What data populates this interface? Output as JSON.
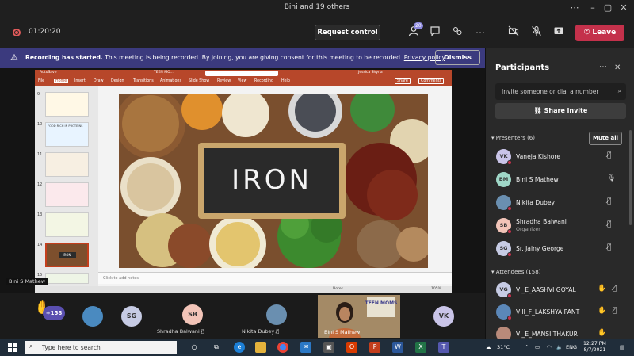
{
  "window": {
    "title": "Bini and 19 others"
  },
  "toolbar": {
    "timer": "01:20:20",
    "request_control": "Request control",
    "participants_badge": "20",
    "leave": "Leave"
  },
  "banner": {
    "bold": "Recording has started.",
    "text": " This meeting is being recorded. By joining, you are giving consent for this meeting to be recorded. ",
    "link": "Privacy policy",
    "dismiss": "Dismiss"
  },
  "ppt": {
    "autosave": "AutoSave",
    "doc_title": "TEEN MO...",
    "search": "Search",
    "user": "Jessica Shyna",
    "tabs": [
      "File",
      "Home",
      "Insert",
      "Draw",
      "Design",
      "Transitions",
      "Animations",
      "Slide Show",
      "Review",
      "View",
      "Recording",
      "Help"
    ],
    "share": "Share",
    "comments": "Comments",
    "thumbs": [
      "9",
      "10",
      "11",
      "12",
      "13",
      "14",
      "15"
    ],
    "thumb_texts": [
      "FOOD RICH IN PROTEINS",
      "IRON"
    ],
    "slide_word": "IRON",
    "notes": "Click to add notes",
    "status_notes": "Notes",
    "zoom": "105%"
  },
  "stage": {
    "presenter_label": "Bini S Mathew"
  },
  "panel": {
    "title": "Participants",
    "invite_placeholder": "Invite someone or dial a number",
    "share_invite": "Share invite",
    "presenters_head": "Presenters (6)",
    "mute_all": "Mute all",
    "attendees_head": "Attendees (158)",
    "presenters": [
      {
        "initials": "VK",
        "name": "Vaneja Kishore",
        "role": "",
        "color": "#c9c4e8"
      },
      {
        "initials": "BM",
        "name": "Bini S Mathew",
        "role": "",
        "color": "#9fd7c7"
      },
      {
        "initials": "",
        "name": "Nikita Dubey",
        "role": "",
        "color": "#6a8fb0"
      },
      {
        "initials": "SB",
        "name": "Shradha Balwani",
        "role": "Organizer",
        "color": "#f2c4b8"
      },
      {
        "initials": "SG",
        "name": "Sr. Jainy George",
        "role": "",
        "color": "#c6cbe4"
      }
    ],
    "attendees": [
      {
        "initials": "VG",
        "name": "VI_E_AASHVI GOYAL",
        "color": "#c6cbe4"
      },
      {
        "initials": "",
        "name": "VIII_F_LAKSHYA PANT",
        "color": "#5b87b8"
      },
      {
        "initials": "",
        "name": "VI_E_MANSI THAKUR",
        "color": "#b98a7a"
      }
    ]
  },
  "gallery": {
    "raised_count": "+158",
    "tiles": [
      {
        "initials": "",
        "name": "",
        "color": "#4a8ac0"
      },
      {
        "initials": "SG",
        "name": "",
        "color": "#c6cbe4"
      },
      {
        "initials": "SB",
        "name": "Shradha Balwani",
        "color": "#f2c4b8"
      },
      {
        "initials": "",
        "name": "Nikita Dubey",
        "color": "#6a8fb0"
      },
      {
        "initials": "VK",
        "name": "",
        "color": "#c9c4e8"
      }
    ],
    "video_name": "Bini S Mathew",
    "video_sign": "TEEN MOMS"
  },
  "taskbar": {
    "search": "Type here to search",
    "temp": "31°C",
    "lang": "ENG",
    "time": "12:27 PM",
    "date": "8/7/2021"
  }
}
